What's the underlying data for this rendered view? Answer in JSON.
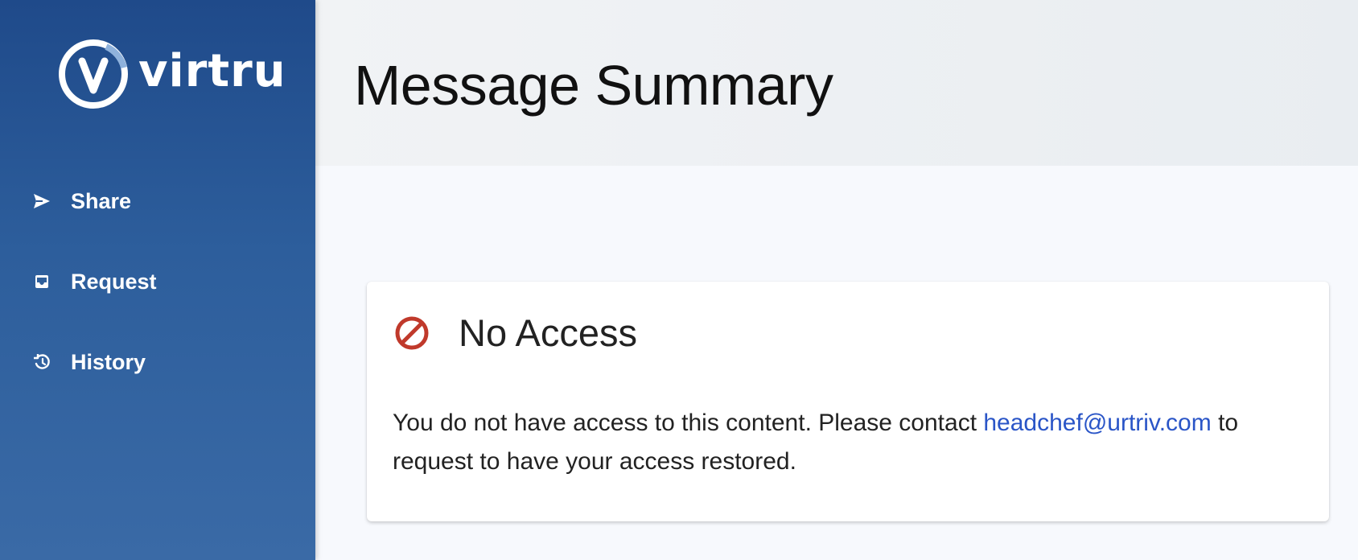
{
  "brand": {
    "name": "virtru"
  },
  "sidebar": {
    "items": [
      {
        "label": "Share",
        "icon": "send-icon"
      },
      {
        "label": "Request",
        "icon": "inbox-icon"
      },
      {
        "label": "History",
        "icon": "history-icon"
      }
    ]
  },
  "header": {
    "title": "Message Summary"
  },
  "card": {
    "title": "No Access",
    "icon": "no-access-icon",
    "message_before": "You do not have access to this content. Please contact ",
    "email": "headchef@urtriv.com",
    "message_after": " to request to have your access restored."
  },
  "colors": {
    "sidebar_top": "#1f4a8a",
    "sidebar_bottom": "#3a6aa6",
    "link": "#2a55c7",
    "error_icon": "#c0392b",
    "header_bg": "#eef1f4",
    "page_bg": "#f7f9fd"
  }
}
